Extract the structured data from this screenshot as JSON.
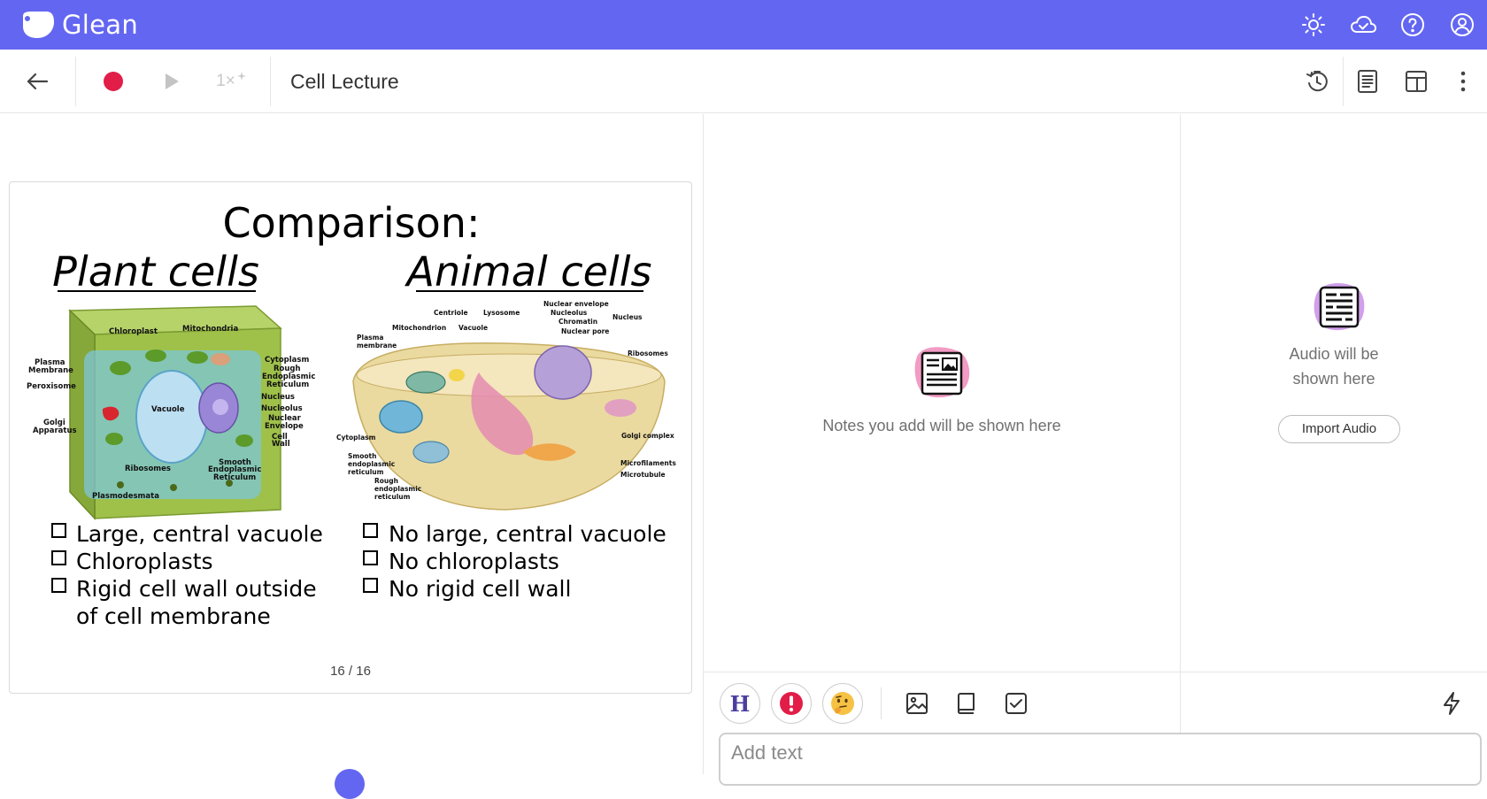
{
  "app": {
    "name": "Glean",
    "accent": "#6366f1"
  },
  "header_icons": [
    "sun-icon",
    "cloud-icon",
    "help-icon",
    "account-icon"
  ],
  "toolbar": {
    "title": "Cell Lecture",
    "speed": "1×",
    "record_color": "#e11d48",
    "icons": [
      "back-arrow-icon",
      "record-icon",
      "play-icon",
      "timer-icon",
      "notes-list-icon",
      "layout-icon",
      "more-vertical-icon"
    ]
  },
  "slide": {
    "title": "Comparison:",
    "plant_heading": "Plant cells",
    "animal_heading": "Animal cells",
    "plant_points": [
      "Large, central vacuole",
      "Chloroplasts",
      "Rigid cell wall outside",
      "of cell membrane"
    ],
    "animal_points": [
      "No large, central vacuole",
      "No chloroplasts",
      "No rigid cell wall"
    ],
    "plant_labels": [
      "Chloroplast",
      "Mitochondria",
      "Plasma",
      "Membrane",
      "Peroxisome",
      "Cytoplasm",
      "Rough",
      "Endoplasmic",
      "Reticulum",
      "Nucleus",
      "Nucleolus",
      "Nuclear",
      "Envelope",
      "Cell",
      "Wall",
      "Vacuole",
      "Golgi",
      "Apparatus",
      "Smooth",
      "Endoplasmic",
      "Reticulum",
      "Ribosomes",
      "Plasmodesmata"
    ],
    "animal_labels": [
      "Nuclear envelope",
      "Nucleolus",
      "Chromatin",
      "Nuclear pore",
      "Nucleus",
      "Centriole",
      "Lysosome",
      "Mitochondrion",
      "Vacuole",
      "Plasma",
      "membrane",
      "Ribosomes",
      "Cytoplasm",
      "Golgi complex",
      "Smooth",
      "endoplasmic",
      "reticulum",
      "Microfilaments",
      "Microtubule",
      "Rough",
      "endoplasmic",
      "reticulum"
    ],
    "page": "16 / 16"
  },
  "notes": {
    "empty_text": "Notes you add will be shown here",
    "input_placeholder": "Add text",
    "tool_icons": [
      "heading-icon",
      "important-icon",
      "thinking-face-icon",
      "image-icon",
      "book-icon",
      "checkbox-icon",
      "lightning-icon"
    ],
    "heading_label": "H"
  },
  "audio": {
    "empty_line1": "Audio will be",
    "empty_line2": "shown here",
    "import_label": "Import Audio"
  }
}
